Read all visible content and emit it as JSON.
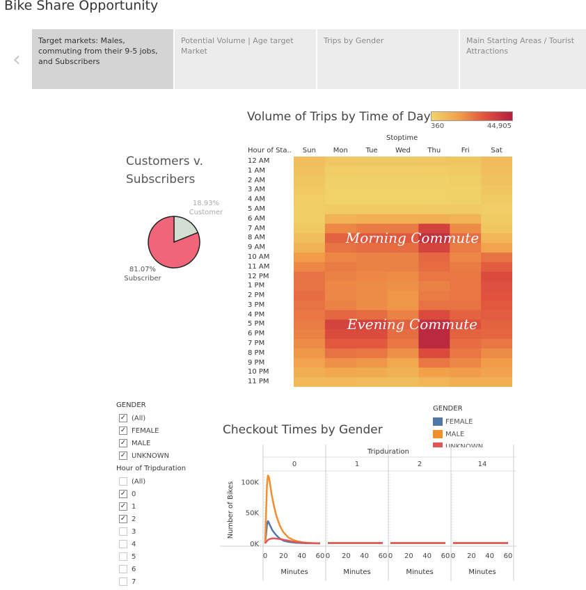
{
  "page": {
    "title": "Bike Share Opportunity"
  },
  "story": {
    "tabs": [
      {
        "label": "Target markets:  Males, commuting from their 9-5 jobs, and Subscribers",
        "active": true
      },
      {
        "label": "Potential Volume | Age target Market",
        "active": false
      },
      {
        "label": "Trips by Gender",
        "active": false
      },
      {
        "label": "Main Starting Areas / Tourist Attractions",
        "active": false
      }
    ],
    "prev_icon": "chevron-left-icon"
  },
  "chart_data": [
    {
      "type": "heatmap",
      "title": "Volume of Trips by Time of Day",
      "column_axis_title": "Stoptime",
      "row_header": "Hour of Sta..",
      "columns": [
        "Sun",
        "Mon",
        "Tue",
        "Wed",
        "Thu",
        "Fri",
        "Sat"
      ],
      "rows": [
        "12 AM",
        "1 AM",
        "2 AM",
        "3 AM",
        "4 AM",
        "5 AM",
        "6 AM",
        "7 AM",
        "8 AM",
        "9 AM",
        "10 AM",
        "11 AM",
        "12 PM",
        "1 PM",
        "2 PM",
        "3 PM",
        "4 PM",
        "5 PM",
        "6 PM",
        "7 PM",
        "8 PM",
        "9 PM",
        "10 PM",
        "11 PM"
      ],
      "legend": {
        "min": "360",
        "max": "44,905",
        "colors": [
          "#f0d46a",
          "#f1a04a",
          "#e0523e",
          "#b21f3f"
        ]
      },
      "values": [
        [
          6500,
          4000,
          3800,
          3800,
          4000,
          4500,
          7200
        ],
        [
          5500,
          2500,
          2300,
          2300,
          2500,
          3000,
          6500
        ],
        [
          4500,
          1500,
          1400,
          1400,
          1500,
          2000,
          5500
        ],
        [
          3500,
          1000,
          900,
          900,
          1000,
          1300,
          4500
        ],
        [
          2500,
          1000,
          900,
          900,
          1000,
          1100,
          3200
        ],
        [
          2000,
          3000,
          3000,
          3000,
          3100,
          2800,
          2300
        ],
        [
          2500,
          10000,
          10500,
          10500,
          11000,
          9500,
          3000
        ],
        [
          3500,
          20000,
          22000,
          22000,
          35000,
          19000,
          4500
        ],
        [
          6500,
          27000,
          29000,
          29000,
          40000,
          25000,
          9000
        ],
        [
          10000,
          24000,
          25000,
          25000,
          34000,
          22000,
          14000
        ],
        [
          16000,
          20000,
          21000,
          21000,
          26000,
          20000,
          24000
        ],
        [
          20000,
          22000,
          21000,
          21000,
          25000,
          22000,
          28000
        ],
        [
          24000,
          21000,
          20000,
          19000,
          23000,
          23000,
          32000
        ],
        [
          24000,
          20000,
          19000,
          18000,
          21000,
          23000,
          31000
        ],
        [
          25000,
          20000,
          19000,
          17000,
          22000,
          23000,
          30000
        ],
        [
          24000,
          21000,
          19000,
          17000,
          24000,
          24000,
          29000
        ],
        [
          23000,
          26000,
          25000,
          21000,
          32000,
          27000,
          28000
        ],
        [
          22000,
          34000,
          34000,
          27000,
          40000,
          31000,
          27000
        ],
        [
          21000,
          32000,
          32000,
          25000,
          42000,
          27000,
          26000
        ],
        [
          19000,
          29000,
          29000,
          23000,
          42000,
          25000,
          23000
        ],
        [
          17000,
          24000,
          23000,
          18000,
          32000,
          23000,
          19000
        ],
        [
          14000,
          18000,
          17000,
          13000,
          23000,
          20000,
          16000
        ],
        [
          11000,
          13000,
          12000,
          10000,
          15000,
          16000,
          14000
        ],
        [
          8000,
          8000,
          7500,
          7000,
          9000,
          11000,
          11000
        ]
      ],
      "annotations": [
        "Morning Commute",
        "Evening Commute"
      ]
    },
    {
      "type": "pie",
      "title": "Customers v. Subscribers",
      "slices": [
        {
          "name": "Customer",
          "value": 18.93,
          "label": "18.93%",
          "color": "#d4dfd4"
        },
        {
          "name": "Subscriber",
          "value": 81.07,
          "label": "81.07%",
          "color": "#f06579"
        }
      ]
    },
    {
      "type": "line",
      "title": "Checkout Times by Gender",
      "column_axis_title": "Tripduration",
      "panels": [
        "0",
        "1",
        "2",
        "14"
      ],
      "xlabel": "Minutes",
      "ylabel": "Number of Bikes",
      "x_ticks": [
        "0",
        "20",
        "40",
        "60"
      ],
      "y_ticks": [
        "0K",
        "50K",
        "100K"
      ],
      "xlim": [
        0,
        60
      ],
      "ylim": [
        0,
        115000
      ],
      "x": [
        0,
        1,
        2,
        3,
        4,
        5,
        6,
        7,
        8,
        10,
        12,
        14,
        16,
        18,
        20,
        25,
        30,
        35,
        40,
        45,
        50,
        55,
        60
      ],
      "series": [
        {
          "name": "FEMALE",
          "color": "#4e79a7",
          "values": [
            0,
            15000,
            30000,
            36000,
            34000,
            30000,
            27000,
            24000,
            21000,
            17000,
            13500,
            10500,
            8000,
            6000,
            4500,
            2500,
            1500,
            900,
            500,
            300,
            200,
            100,
            50
          ]
        },
        {
          "name": "MALE",
          "color": "#f28e2b",
          "values": [
            0,
            50000,
            95000,
            110000,
            108000,
            100000,
            90000,
            80000,
            72000,
            58000,
            46000,
            37000,
            29000,
            23000,
            18000,
            10000,
            6000,
            3500,
            2000,
            1200,
            700,
            400,
            200
          ]
        },
        {
          "name": "UNKNOWN",
          "color": "#e15759",
          "values": [
            0,
            2000,
            4000,
            5500,
            6500,
            7000,
            7500,
            7800,
            8000,
            8000,
            7800,
            7500,
            7000,
            6500,
            6000,
            4500,
            3000,
            2000,
            1200,
            700,
            400,
            200,
            100
          ]
        }
      ],
      "flat_panels_value": 500
    }
  ],
  "filters": {
    "gender": {
      "title": "GENDER",
      "items": [
        {
          "label": "(All)",
          "checked": true
        },
        {
          "label": "FEMALE",
          "checked": true
        },
        {
          "label": "MALE",
          "checked": true
        },
        {
          "label": "UNKNOWN",
          "checked": true
        }
      ]
    },
    "hour": {
      "title": "Hour of Tripduration",
      "items": [
        {
          "label": "(All)",
          "checked": false
        },
        {
          "label": "0",
          "checked": true
        },
        {
          "label": "1",
          "checked": true
        },
        {
          "label": "2",
          "checked": true
        },
        {
          "label": "3",
          "checked": false
        },
        {
          "label": "4",
          "checked": false
        },
        {
          "label": "5",
          "checked": false
        },
        {
          "label": "6",
          "checked": false
        },
        {
          "label": "7",
          "checked": false
        }
      ]
    }
  },
  "gender_legend": {
    "title": "GENDER",
    "items": [
      {
        "label": "FEMALE",
        "color": "#4e79a7"
      },
      {
        "label": "MALE",
        "color": "#f28e2b"
      },
      {
        "label": "UNKNOWN",
        "color": "#e15759"
      }
    ]
  }
}
